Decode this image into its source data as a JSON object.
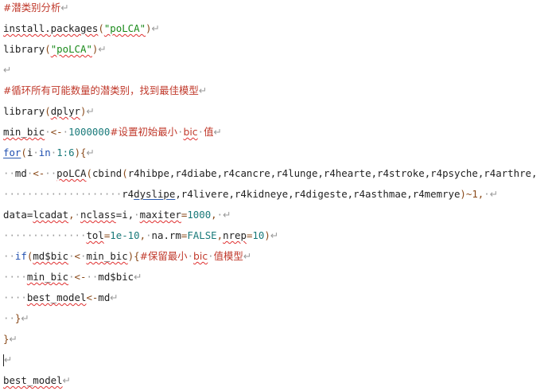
{
  "doc": {
    "lines": [
      [
        {
          "t": "#潜类别分析",
          "c": "cmt"
        },
        {
          "t": "↵",
          "c": "mk"
        }
      ],
      [
        {
          "t": "install.packages",
          "c": "fn",
          "u": "sq"
        },
        {
          "t": "(",
          "c": "op"
        },
        {
          "t": "\"poLCA\"",
          "c": "str",
          "u": "sq"
        },
        {
          "t": ")",
          "c": "op"
        },
        {
          "t": "↵",
          "c": "mk"
        }
      ],
      [
        {
          "t": "library",
          "c": "fn"
        },
        {
          "t": "(",
          "c": "op"
        },
        {
          "t": "\"poLCA\"",
          "c": "str",
          "u": "sq"
        },
        {
          "t": ")",
          "c": "op"
        },
        {
          "t": "↵",
          "c": "mk"
        }
      ],
      [
        {
          "t": "↵",
          "c": "mk"
        }
      ],
      [
        {
          "t": "#循环所有可能数量的潜类别，找到最佳模型",
          "c": "cmt"
        },
        {
          "t": "↵",
          "c": "mk"
        }
      ],
      [
        {
          "t": "library",
          "c": "fn"
        },
        {
          "t": "(",
          "c": "op"
        },
        {
          "t": "dplyr",
          "c": "fn",
          "u": "sq"
        },
        {
          "t": ")",
          "c": "op"
        },
        {
          "t": "↵",
          "c": "mk"
        }
      ],
      [
        {
          "t": "min_bic",
          "c": "fn",
          "u": "sq"
        },
        {
          "t": "·",
          "c": "dot"
        },
        {
          "t": "<-",
          "c": "op"
        },
        {
          "t": "·",
          "c": "dot"
        },
        {
          "t": "1000000",
          "c": "num"
        },
        {
          "t": "#设置初始最小",
          "c": "cmt"
        },
        {
          "t": "·",
          "c": "dot"
        },
        {
          "t": "bic",
          "c": "cmt",
          "u": "sq"
        },
        {
          "t": "·",
          "c": "dot"
        },
        {
          "t": "值",
          "c": "cmt"
        },
        {
          "t": "↵",
          "c": "mk"
        }
      ],
      [
        {
          "t": "for",
          "c": "kw",
          "u": "ul"
        },
        {
          "t": "(",
          "c": "op"
        },
        {
          "t": "i",
          "c": "fn"
        },
        {
          "t": "·",
          "c": "dot"
        },
        {
          "t": "in",
          "c": "kw"
        },
        {
          "t": "·",
          "c": "dot"
        },
        {
          "t": "1:6",
          "c": "num"
        },
        {
          "t": "){",
          "c": "op"
        },
        {
          "t": "↵",
          "c": "mk"
        }
      ],
      [
        {
          "t": "··",
          "c": "dot"
        },
        {
          "t": "md",
          "c": "fn"
        },
        {
          "t": "·",
          "c": "dot"
        },
        {
          "t": "<-",
          "c": "op"
        },
        {
          "t": "··",
          "c": "dot"
        },
        {
          "t": "poLCA",
          "c": "fn",
          "u": "sq"
        },
        {
          "t": "(",
          "c": "op"
        },
        {
          "t": "cbind",
          "c": "fn"
        },
        {
          "t": "(",
          "c": "op"
        },
        {
          "t": "r4hibpe,r4diabe,r4cancre,r4lunge,r4hearte,r4stroke,r4psyche,r4arthre,",
          "c": "fn"
        }
      ],
      [
        {
          "t": "····················",
          "c": "dot"
        },
        {
          "t": "r4",
          "c": "fn"
        },
        {
          "t": "dyslipe",
          "c": "fn",
          "u": "ul"
        },
        {
          "t": ",r4livere,r4kidneye,r4digeste,r4asthmae,r4memrye",
          "c": "fn"
        },
        {
          "t": ")~1,",
          "c": "op"
        },
        {
          "t": "·",
          "c": "dot"
        },
        {
          "t": "↵",
          "c": "mk"
        }
      ],
      [
        {
          "t": "data=",
          "c": "fn"
        },
        {
          "t": "lcadat",
          "c": "fn",
          "u": "sq"
        },
        {
          "t": ",",
          "c": "op"
        },
        {
          "t": "·",
          "c": "dot"
        },
        {
          "t": "nclass",
          "c": "fn",
          "u": "sq"
        },
        {
          "t": "=i,",
          "c": "fn"
        },
        {
          "t": "·",
          "c": "dot"
        },
        {
          "t": "maxiter",
          "c": "fn",
          "u": "sq"
        },
        {
          "t": "=",
          "c": "op"
        },
        {
          "t": "1000",
          "c": "num"
        },
        {
          "t": ",",
          "c": "op"
        },
        {
          "t": "·",
          "c": "dot"
        },
        {
          "t": "↵",
          "c": "mk"
        }
      ],
      [
        {
          "t": "··············",
          "c": "dot"
        },
        {
          "t": "tol",
          "c": "fn",
          "u": "sq"
        },
        {
          "t": "=",
          "c": "op"
        },
        {
          "t": "1e-10",
          "c": "num"
        },
        {
          "t": ",",
          "c": "op"
        },
        {
          "t": "·",
          "c": "dot"
        },
        {
          "t": "na.rm",
          "c": "fn"
        },
        {
          "t": "=",
          "c": "op"
        },
        {
          "t": "FALSE",
          "c": "num"
        },
        {
          "t": ",",
          "c": "op"
        },
        {
          "t": "nrep",
          "c": "fn",
          "u": "sq"
        },
        {
          "t": "=",
          "c": "op"
        },
        {
          "t": "10",
          "c": "num"
        },
        {
          "t": ")",
          "c": "op"
        },
        {
          "t": "↵",
          "c": "mk"
        }
      ],
      [
        {
          "t": "··",
          "c": "dot"
        },
        {
          "t": "if",
          "c": "kw"
        },
        {
          "t": "(",
          "c": "op"
        },
        {
          "t": "md$bic",
          "c": "fn",
          "u": "sq"
        },
        {
          "t": "·",
          "c": "dot"
        },
        {
          "t": "<",
          "c": "op"
        },
        {
          "t": "·",
          "c": "dot"
        },
        {
          "t": "min_bic",
          "c": "fn",
          "u": "sq"
        },
        {
          "t": "){",
          "c": "op"
        },
        {
          "t": "#保留最小",
          "c": "cmt"
        },
        {
          "t": "·",
          "c": "dot"
        },
        {
          "t": "bic",
          "c": "cmt",
          "u": "sq"
        },
        {
          "t": "·",
          "c": "dot"
        },
        {
          "t": "值模型",
          "c": "cmt"
        },
        {
          "t": "↵",
          "c": "mk"
        }
      ],
      [
        {
          "t": "····",
          "c": "dot"
        },
        {
          "t": "min_bic",
          "c": "fn",
          "u": "sq"
        },
        {
          "t": "·",
          "c": "dot"
        },
        {
          "t": "<-",
          "c": "op"
        },
        {
          "t": "··",
          "c": "dot"
        },
        {
          "t": "md$bic",
          "c": "fn"
        },
        {
          "t": "↵",
          "c": "mk"
        }
      ],
      [
        {
          "t": "····",
          "c": "dot"
        },
        {
          "t": "best_model",
          "c": "fn",
          "u": "sq"
        },
        {
          "t": "<-",
          "c": "op"
        },
        {
          "t": "md",
          "c": "fn"
        },
        {
          "t": "↵",
          "c": "mk"
        }
      ],
      [
        {
          "t": "··",
          "c": "dot"
        },
        {
          "t": "}",
          "c": "op"
        },
        {
          "t": "↵",
          "c": "mk"
        }
      ],
      [
        {
          "t": "}",
          "c": "op"
        },
        {
          "t": "↵",
          "c": "mk"
        }
      ],
      [
        {
          "t": "|",
          "c": "cursor"
        },
        {
          "t": "↵",
          "c": "mk"
        }
      ],
      [
        {
          "t": "best_model",
          "c": "fn",
          "u": "sq"
        },
        {
          "t": "↵",
          "c": "mk"
        }
      ]
    ]
  }
}
